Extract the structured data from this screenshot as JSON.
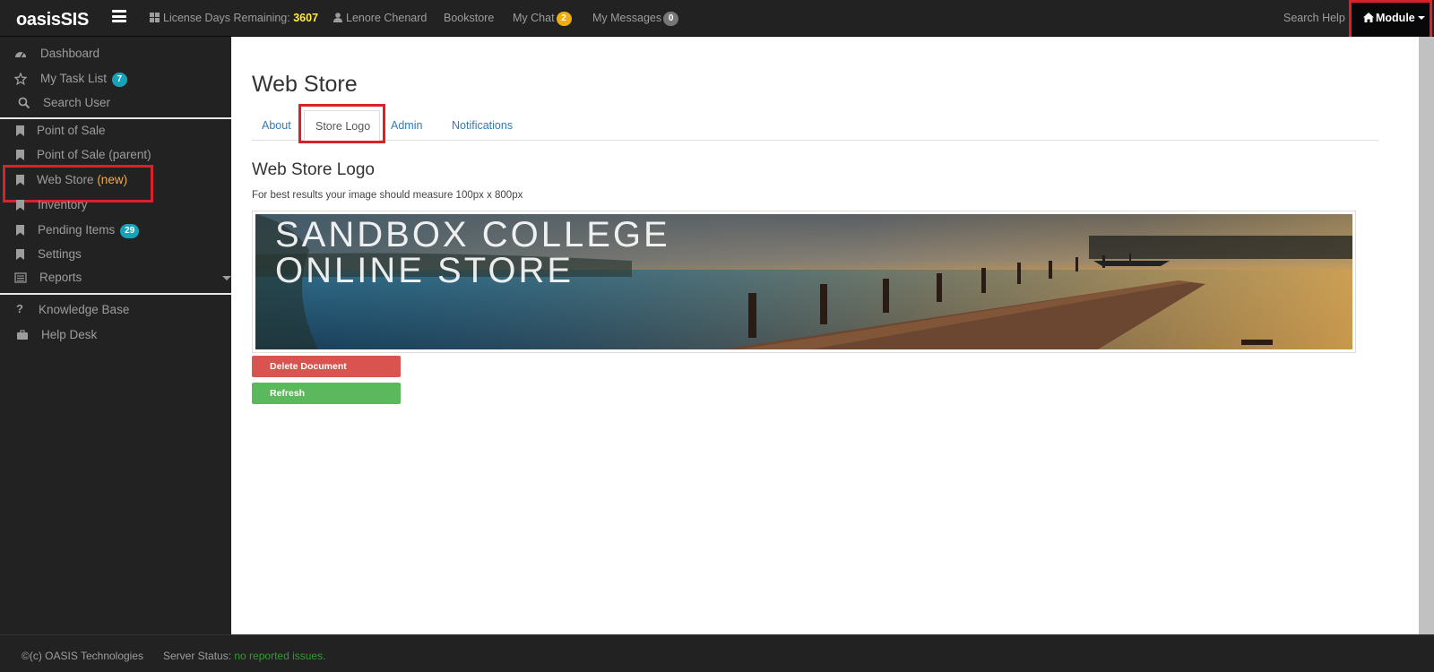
{
  "navbar": {
    "brand": "oasisSIS",
    "license_label": "License Days Remaining:",
    "license_value": "3607",
    "user_name": "Lenore Chenard",
    "bookstore": "Bookstore",
    "my_chat": "My Chat",
    "my_chat_count": "2",
    "my_messages": "My Messages",
    "my_messages_count": "0",
    "search_help": "Search Help",
    "module": "Module"
  },
  "sidebar": {
    "dashboard": "Dashboard",
    "task_list": "My Task List",
    "task_list_count": "7",
    "search_user": "Search User",
    "point_of_sale": "Point of Sale",
    "point_of_sale_parent": "Point of Sale (parent)",
    "web_store": "Web Store",
    "web_store_tag": "(new)",
    "inventory": "Inventory",
    "pending_items": "Pending Items",
    "pending_items_count": "29",
    "settings": "Settings",
    "reports": "Reports",
    "knowledge_base": "Knowledge Base",
    "help_desk": "Help Desk"
  },
  "main": {
    "title": "Web Store",
    "tabs": [
      {
        "label": "About"
      },
      {
        "label": "Store Logo"
      },
      {
        "label": "Admin"
      },
      {
        "label": "Notifications"
      }
    ],
    "section_title": "Web Store Logo",
    "hint": "For best results your image should measure 100px x 800px",
    "logo": {
      "line1": "SANDBOX COLLEGE",
      "line2": "ONLINE STORE"
    },
    "delete_button": "Delete Document",
    "refresh_button": "Refresh"
  },
  "footer": {
    "copyright": "©(c) OASIS Technologies",
    "server_status_label": "Server Status:",
    "server_status_value": "no reported issues."
  },
  "colors": {
    "navbar_bg": "#222222",
    "accent_link": "#337ab7",
    "danger": "#d9534f",
    "success": "#5cb85c",
    "highlight_box": "#d8222a"
  }
}
